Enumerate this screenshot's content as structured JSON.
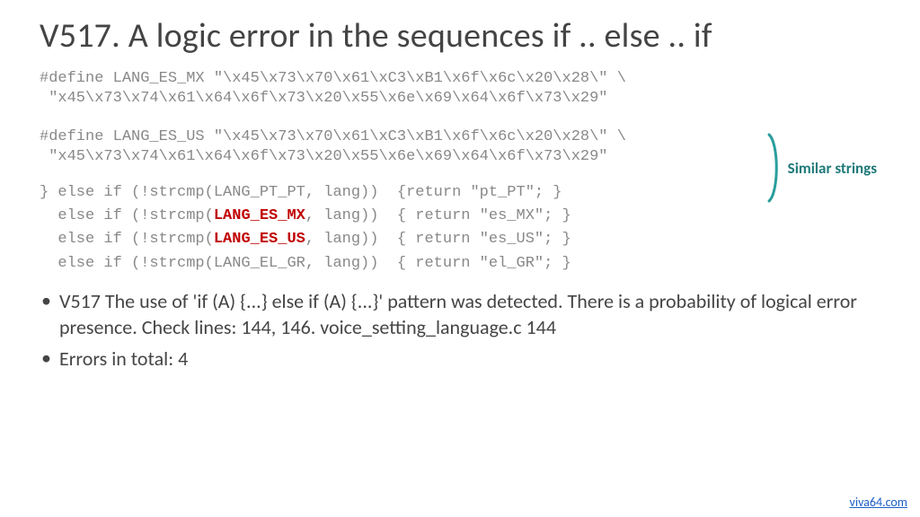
{
  "title": "V517. A logic error in the sequences if .. else .. if",
  "define1_l1": "#define LANG_ES_MX \"\\x45\\x73\\x70\\x61\\xC3\\xB1\\x6f\\x6c\\x20\\x28\\\" \\",
  "define1_l2": " \"x45\\x73\\x74\\x61\\x64\\x6f\\x73\\x20\\x55\\x6e\\x69\\x64\\x6f\\x73\\x29\"",
  "define2_l1": "#define LANG_ES_US \"\\x45\\x73\\x70\\x61\\xC3\\xB1\\x6f\\x6c\\x20\\x28\\\" \\",
  "define2_l2": " \"x45\\x73\\x74\\x61\\x64\\x6f\\x73\\x20\\x55\\x6e\\x69\\x64\\x6f\\x73\\x29\"",
  "code_line1_a": "} else if (!strcmp(LANG_PT_PT, lang))  {return \"pt_PT\"; }",
  "code_line2_a": "  else if (!strcmp(",
  "code_line2_b": "LANG_ES_MX",
  "code_line2_c": ", lang))  { return \"es_MX\"; }",
  "code_line3_a": "  else if (!strcmp(",
  "code_line3_b": "LANG_ES_US",
  "code_line3_c": ", lang))  { return \"es_US\"; }",
  "code_line4_a": "  else if (!strcmp(LANG_EL_GR, lang))  { return \"el_GR\"; }",
  "annotation": "Similar strings",
  "bullet1": "V517 The use of 'if (A) {...} else if (A) {...}' pattern was detected. There is a probability of logical error presence. Check lines: 144, 146. voice_setting_language.c 144",
  "bullet2": "Errors in total: 4",
  "footer": "viva64.com"
}
